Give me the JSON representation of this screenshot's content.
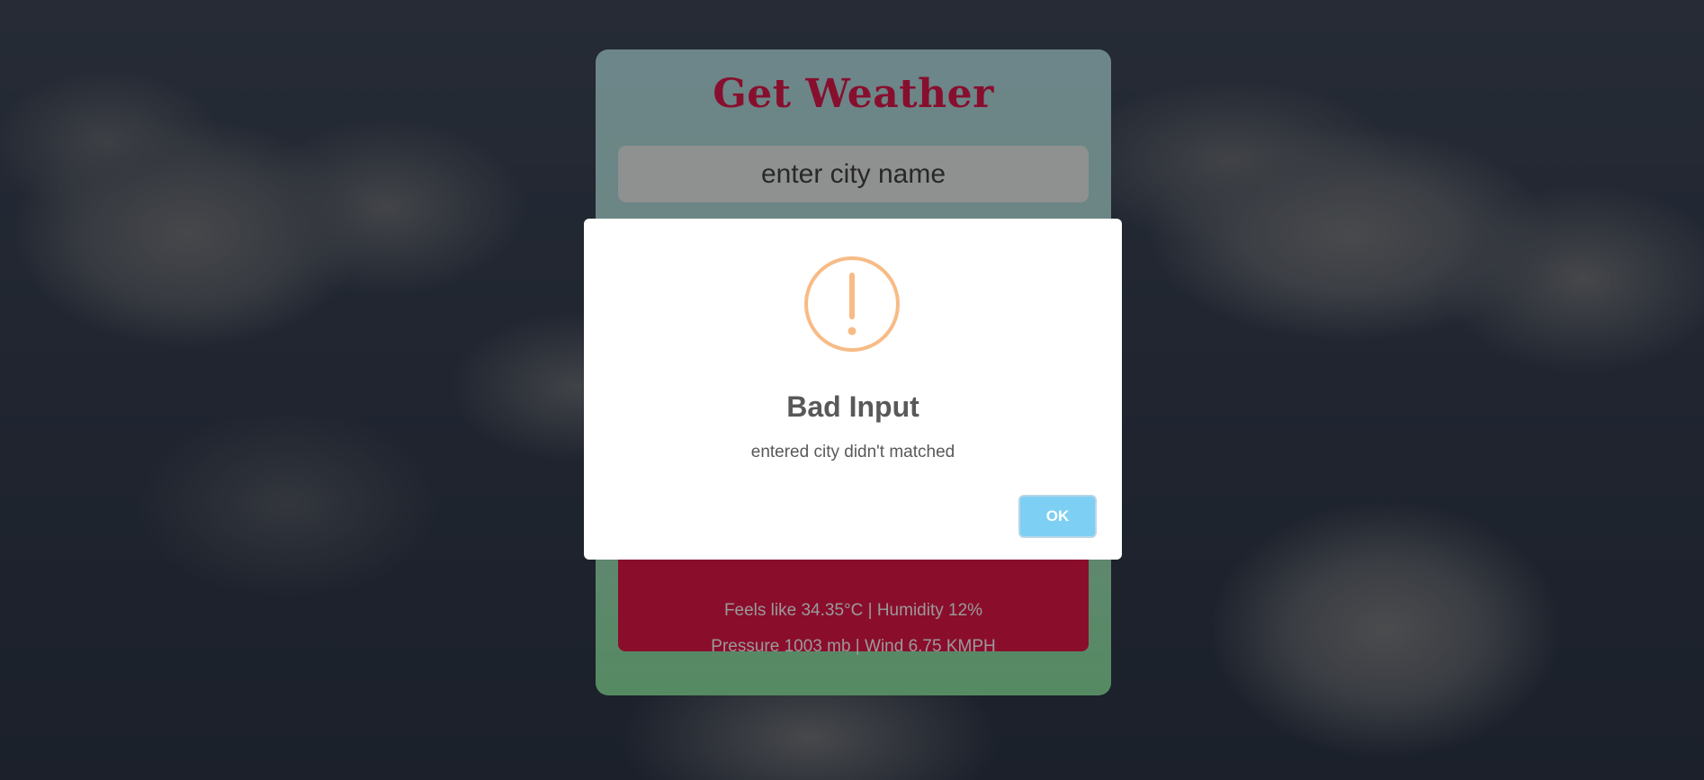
{
  "weather_card": {
    "title": "Get Weather",
    "input_placeholder": "enter city name",
    "result_line_1": "Feels like 34.35°C | Humidity 12%",
    "result_line_2": "Pressure 1003 mb | Wind 6.75 KMPH"
  },
  "alert": {
    "icon": "warning-exclamation-icon",
    "title": "Bad Input",
    "message": "entered city didn't matched",
    "ok_label": "OK"
  },
  "colors": {
    "title": "#e11a4d",
    "result_panel": "#e6174a",
    "warning_icon": "#f8bb86",
    "ok_button": "#7ecff4"
  }
}
